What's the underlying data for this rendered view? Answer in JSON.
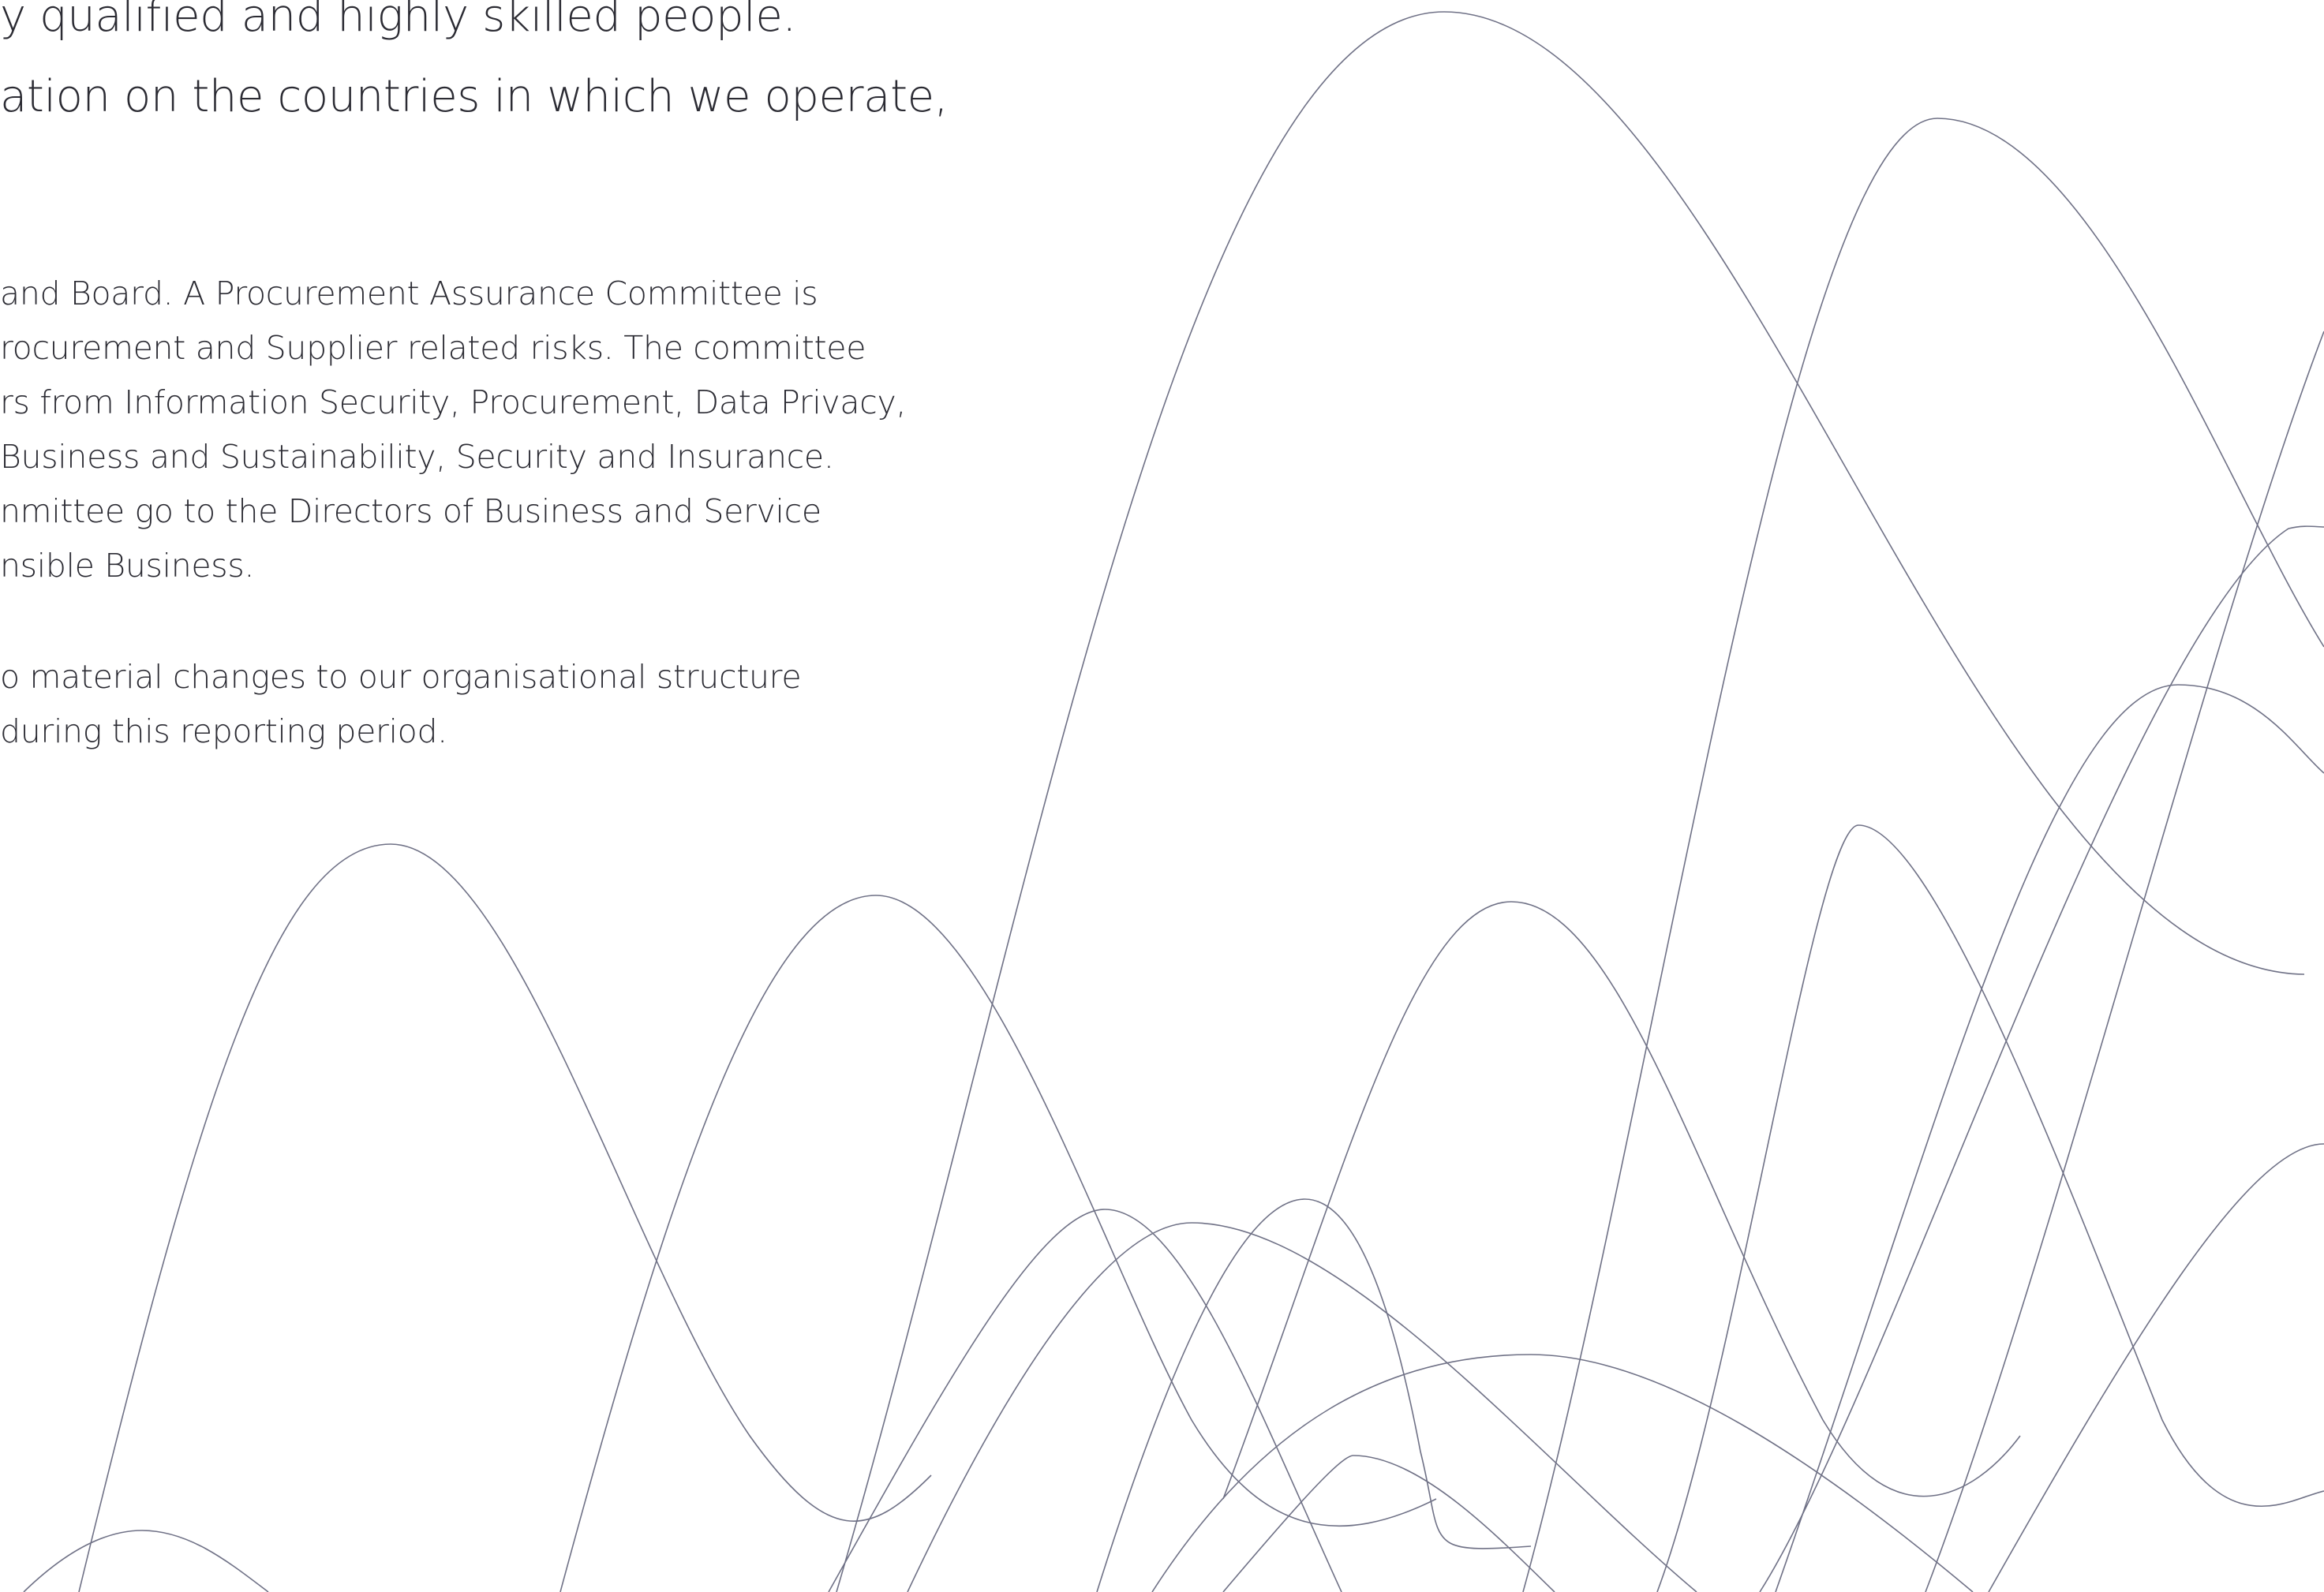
{
  "lead_lines": [
    "y qualified and highly skilled people.",
    "ation on the countries in which we operate,"
  ],
  "paragraph1": [
    " and Board. A Procurement Assurance Committee is",
    "rocurement and Supplier related risks. The committee",
    "rs from Information Security, Procurement, Data Privacy,",
    " Business and Sustainability, Security and Insurance.",
    "nmittee go to the Directors of Business and Service",
    "nsible Business."
  ],
  "paragraph2": [
    "o material changes to our organisational structure",
    " during this reporting period."
  ],
  "decoration": {
    "line_color": "#6f7186"
  }
}
